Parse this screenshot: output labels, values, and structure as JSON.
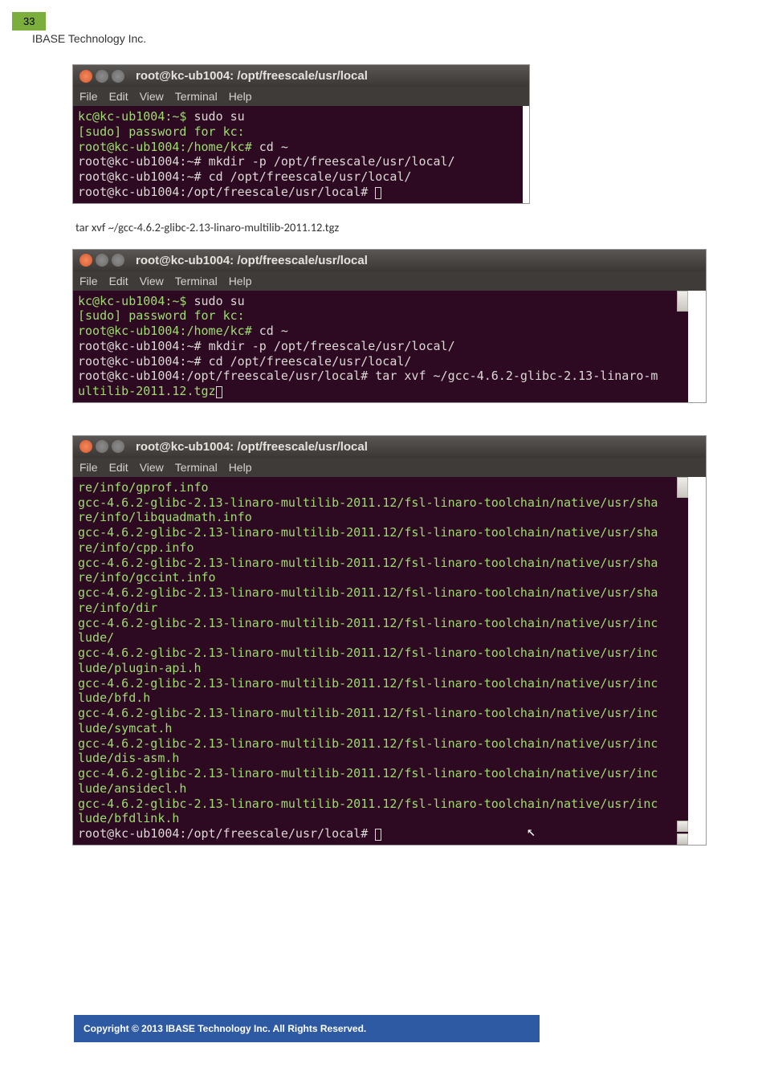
{
  "pageNumber": "33",
  "company": "IBASE Technology Inc.",
  "menu": {
    "file": "File",
    "edit": "Edit",
    "view": "View",
    "terminal": "Terminal",
    "help": "Help"
  },
  "term1": {
    "title": "root@kc-ub1004: /opt/freescale/usr/local",
    "l1_prompt": "kc@kc-ub1004:~$ ",
    "l1_cmd": "sudo su",
    "l2": "[sudo] password for kc:",
    "l3_prompt": "root@kc-ub1004:/home/kc# ",
    "l3_cmd": "cd ~",
    "l4_prompt": "root@kc-ub1004:~# ",
    "l4_cmd": "mkdir -p /opt/freescale/usr/local/",
    "l5_prompt": "root@kc-ub1004:~# ",
    "l5_cmd": "cd /opt/freescale/usr/local/",
    "l6_prompt": "root@kc-ub1004:/opt/freescale/usr/local# "
  },
  "docLine": "tar xvf ~/gcc-4.6.2-glibc-2.13-linaro-multilib-2011.12.tgz",
  "term2": {
    "title": "root@kc-ub1004: /opt/freescale/usr/local",
    "l1_prompt": "kc@kc-ub1004:~$ ",
    "l1_cmd": "sudo su",
    "l2": "[sudo] password for kc:",
    "l3_prompt": "root@kc-ub1004:/home/kc# ",
    "l3_cmd": "cd ~",
    "l4_prompt": "root@kc-ub1004:~# ",
    "l4_cmd": "mkdir -p /opt/freescale/usr/local/",
    "l5_prompt": "root@kc-ub1004:~# ",
    "l5_cmd": "cd /opt/freescale/usr/local/",
    "l6_prompt": "root@kc-ub1004:/opt/freescale/usr/local# ",
    "l6_cmd": "tar xvf ~/gcc-4.6.2-glibc-2.13-linaro-m",
    "l7": "ultilib-2011.12.tgz"
  },
  "term3": {
    "title": "root@kc-ub1004: /opt/freescale/usr/local",
    "body": "re/info/gprof.info\ngcc-4.6.2-glibc-2.13-linaro-multilib-2011.12/fsl-linaro-toolchain/native/usr/sha\nre/info/libquadmath.info\ngcc-4.6.2-glibc-2.13-linaro-multilib-2011.12/fsl-linaro-toolchain/native/usr/sha\nre/info/cpp.info\ngcc-4.6.2-glibc-2.13-linaro-multilib-2011.12/fsl-linaro-toolchain/native/usr/sha\nre/info/gccint.info\ngcc-4.6.2-glibc-2.13-linaro-multilib-2011.12/fsl-linaro-toolchain/native/usr/sha\nre/info/dir\ngcc-4.6.2-glibc-2.13-linaro-multilib-2011.12/fsl-linaro-toolchain/native/usr/inc\nlude/\ngcc-4.6.2-glibc-2.13-linaro-multilib-2011.12/fsl-linaro-toolchain/native/usr/inc\nlude/plugin-api.h\ngcc-4.6.2-glibc-2.13-linaro-multilib-2011.12/fsl-linaro-toolchain/native/usr/inc\nlude/bfd.h\ngcc-4.6.2-glibc-2.13-linaro-multilib-2011.12/fsl-linaro-toolchain/native/usr/inc\nlude/symcat.h\ngcc-4.6.2-glibc-2.13-linaro-multilib-2011.12/fsl-linaro-toolchain/native/usr/inc\nlude/dis-asm.h\ngcc-4.6.2-glibc-2.13-linaro-multilib-2011.12/fsl-linaro-toolchain/native/usr/inc\nlude/ansidecl.h\ngcc-4.6.2-glibc-2.13-linaro-multilib-2011.12/fsl-linaro-toolchain/native/usr/inc\nlude/bfdlink.h",
    "lastPrompt": "root@kc-ub1004:/opt/freescale/usr/local# "
  },
  "footer": "Copyright © 2013 IBASE Technology Inc. All Rights Reserved."
}
